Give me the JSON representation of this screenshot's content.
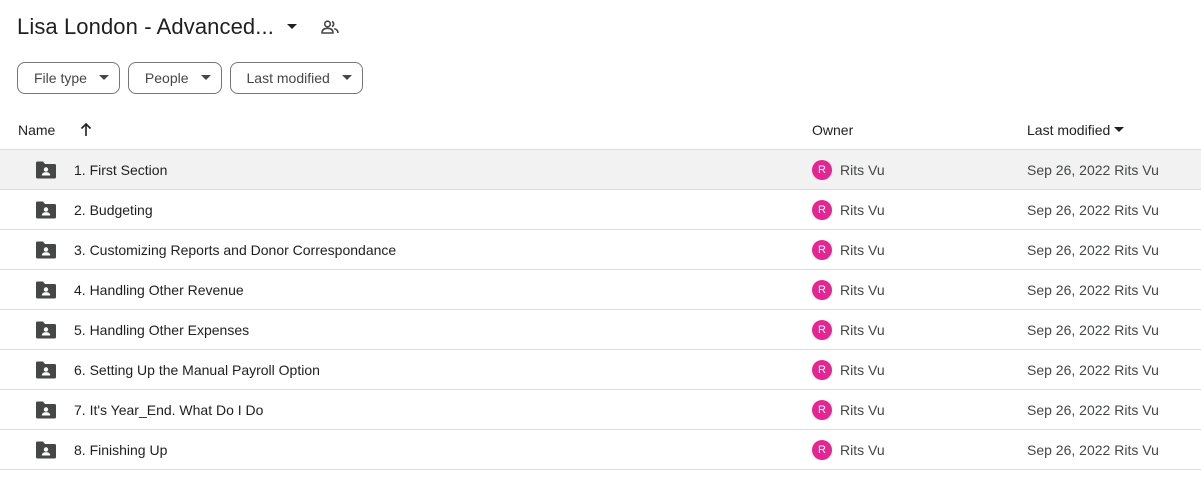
{
  "header": {
    "title": "Lisa London - Advanced...",
    "title_dropdown_icon": "arrow-drop-down-icon",
    "shared_icon": "shared-people-icon"
  },
  "filters": [
    {
      "label": "File type"
    },
    {
      "label": "People"
    },
    {
      "label": "Last modified"
    }
  ],
  "table": {
    "columns": {
      "name": "Name",
      "owner": "Owner",
      "last_modified": "Last modified"
    },
    "sort_icon": "arrow-upward-icon",
    "rows": [
      {
        "name": "1. First Section",
        "owner": "Rits Vu",
        "owner_initial": "R",
        "modified": "Sep 26, 2022",
        "modified_by": "Rits Vu"
      },
      {
        "name": "2. Budgeting",
        "owner": "Rits Vu",
        "owner_initial": "R",
        "modified": "Sep 26, 2022",
        "modified_by": "Rits Vu"
      },
      {
        "name": "3. Customizing Reports and Donor Correspondance",
        "owner": "Rits Vu",
        "owner_initial": "R",
        "modified": "Sep 26, 2022",
        "modified_by": "Rits Vu"
      },
      {
        "name": "4. Handling Other Revenue",
        "owner": "Rits Vu",
        "owner_initial": "R",
        "modified": "Sep 26, 2022",
        "modified_by": "Rits Vu"
      },
      {
        "name": "5. Handling Other Expenses",
        "owner": "Rits Vu",
        "owner_initial": "R",
        "modified": "Sep 26, 2022",
        "modified_by": "Rits Vu"
      },
      {
        "name": "6. Setting Up the Manual Payroll Option",
        "owner": "Rits Vu",
        "owner_initial": "R",
        "modified": "Sep 26, 2022",
        "modified_by": "Rits Vu"
      },
      {
        "name": "7. It's Year_End. What Do I Do",
        "owner": "Rits Vu",
        "owner_initial": "R",
        "modified": "Sep 26, 2022",
        "modified_by": "Rits Vu"
      },
      {
        "name": "8. Finishing Up",
        "owner": "Rits Vu",
        "owner_initial": "R",
        "modified": "Sep 26, 2022",
        "modified_by": "Rits Vu"
      }
    ]
  },
  "colors": {
    "avatar": "#e52592",
    "folder_icon": "#444746",
    "selected_row": "#f2f2f2",
    "divider": "#dadce0"
  }
}
